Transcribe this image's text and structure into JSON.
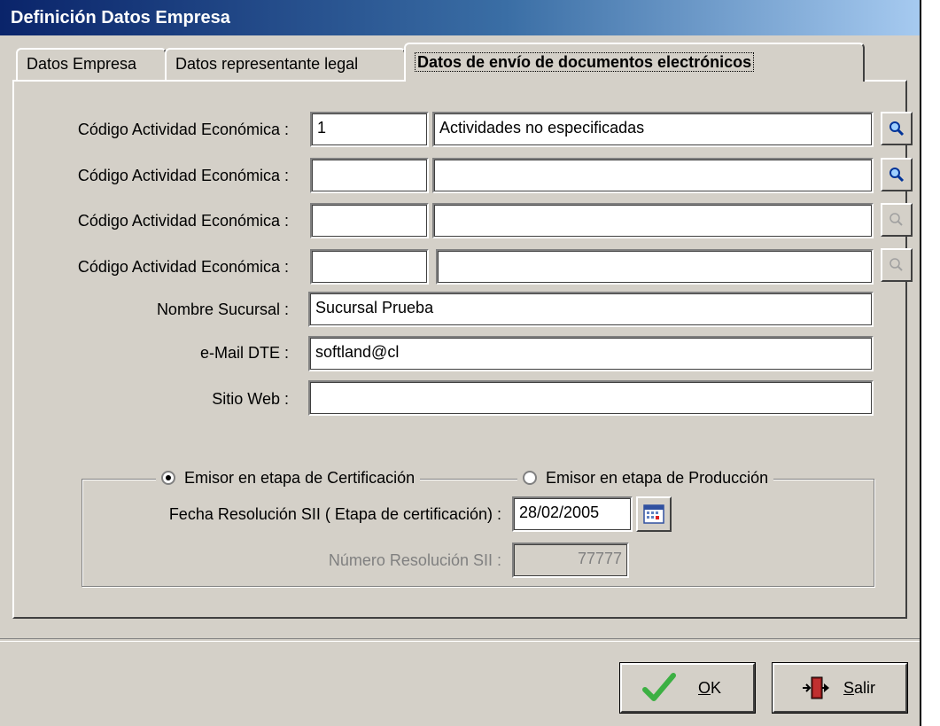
{
  "window": {
    "title": "Definición Datos Empresa"
  },
  "tabs": [
    {
      "label": "Datos Empresa"
    },
    {
      "label": "Datos representante legal"
    },
    {
      "label": "Datos de envío de documentos electrónicos",
      "active": true
    }
  ],
  "activity_rows": [
    {
      "label": "Código Actividad Económica :",
      "code": "1",
      "description": "Actividades no especificadas",
      "search_enabled": true
    },
    {
      "label": "Código Actividad Económica :",
      "code": "",
      "description": "",
      "search_enabled": true
    },
    {
      "label": "Código Actividad Económica :",
      "code": "",
      "description": "",
      "search_enabled": false
    },
    {
      "label": "Código Actividad Económica :",
      "code": "",
      "description": "",
      "search_enabled": false
    }
  ],
  "fields": {
    "branch_label": "Nombre Sucursal :",
    "branch_value": "Sucursal Prueba",
    "email_label": "e-Mail DTE :",
    "email_value": "softland@cl",
    "web_label": "Sitio Web :",
    "web_value": ""
  },
  "emitter": {
    "option_certification": "Emisor en etapa de Certificación",
    "option_production": "Emisor en etapa de Producción",
    "selected": "certification",
    "date_label": "Fecha Resolución SII ( Etapa de certificación) :",
    "date_value": "28/02/2005",
    "number_label": "Número Resolución SII :",
    "number_value": "77777"
  },
  "buttons": {
    "ok": {
      "mnemonic": "O",
      "rest": "K"
    },
    "exit": {
      "mnemonic": "S",
      "rest": "alir"
    }
  },
  "colors": {
    "face": "#d4d0c8",
    "title_start": "#0a246a",
    "ok_check": "#3cb043"
  }
}
